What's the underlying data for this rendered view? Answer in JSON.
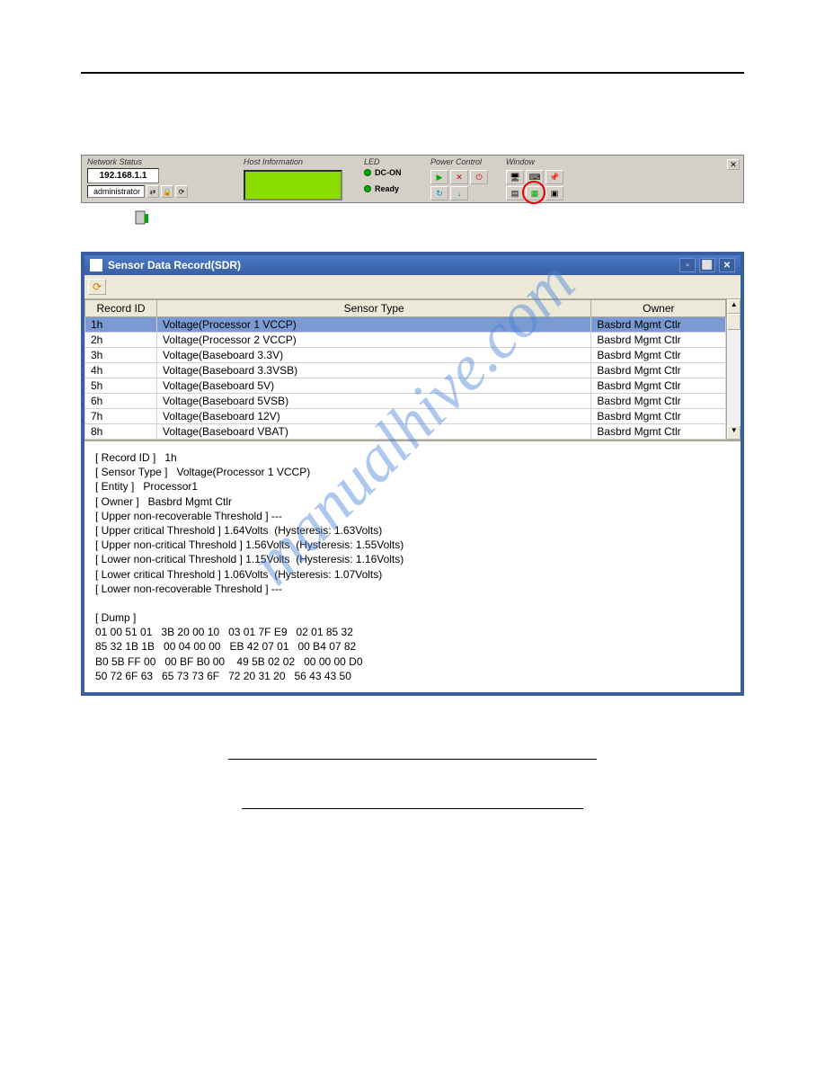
{
  "watermark": "manualhive.com",
  "toolbar": {
    "network_status_label": "Network Status",
    "ip": "192.168.1.1",
    "admin": "administrator",
    "host_info_label": "Host Information",
    "led_label": "LED",
    "led_dcon": "DC-ON",
    "led_ready": "Ready",
    "power_label": "Power Control",
    "window_label": "Window"
  },
  "sdr": {
    "title": "Sensor Data Record(SDR)",
    "headers": {
      "id": "Record ID",
      "type": "Sensor Type",
      "owner": "Owner"
    },
    "rows": [
      {
        "id": "1h",
        "type": "Voltage(Processor 1 VCCP)",
        "owner": "Basbrd Mgmt Ctlr",
        "selected": true
      },
      {
        "id": "2h",
        "type": "Voltage(Processor 2 VCCP)",
        "owner": "Basbrd Mgmt Ctlr"
      },
      {
        "id": "3h",
        "type": "Voltage(Baseboard 3.3V)",
        "owner": "Basbrd Mgmt Ctlr"
      },
      {
        "id": "4h",
        "type": "Voltage(Baseboard 3.3VSB)",
        "owner": "Basbrd Mgmt Ctlr"
      },
      {
        "id": "5h",
        "type": "Voltage(Baseboard 5V)",
        "owner": "Basbrd Mgmt Ctlr"
      },
      {
        "id": "6h",
        "type": "Voltage(Baseboard 5VSB)",
        "owner": "Basbrd Mgmt Ctlr"
      },
      {
        "id": "7h",
        "type": "Voltage(Baseboard 12V)",
        "owner": "Basbrd Mgmt Ctlr"
      },
      {
        "id": "8h",
        "type": "Voltage(Baseboard VBAT)",
        "owner": "Basbrd Mgmt Ctlr"
      }
    ],
    "detail": "[ Record ID ]   1h\n[ Sensor Type ]   Voltage(Processor 1 VCCP)\n[ Entity ]   Processor1\n[ Owner ]   Basbrd Mgmt Ctlr\n[ Upper non-recoverable Threshold ] ---\n[ Upper critical Threshold ] 1.64Volts  (Hysteresis: 1.63Volts)\n[ Upper non-critical Threshold ] 1.56Volts  (Hysteresis: 1.55Volts)\n[ Lower non-critical Threshold ] 1.15Volts  (Hysteresis: 1.16Volts)\n[ Lower critical Threshold ] 1.06Volts  (Hysteresis: 1.07Volts)\n[ Lower non-recoverable Threshold ] ---\n\n[ Dump ]\n01 00 51 01   3B 20 00 10   03 01 7F E9   02 01 85 32\n85 32 1B 1B   00 04 00 00   EB 42 07 01   00 B4 07 82\nB0 5B FF 00   00 BF B0 00    49 5B 02 02   00 00 00 D0\n50 72 6F 63   65 73 73 6F   72 20 31 20   56 43 43 50"
  }
}
